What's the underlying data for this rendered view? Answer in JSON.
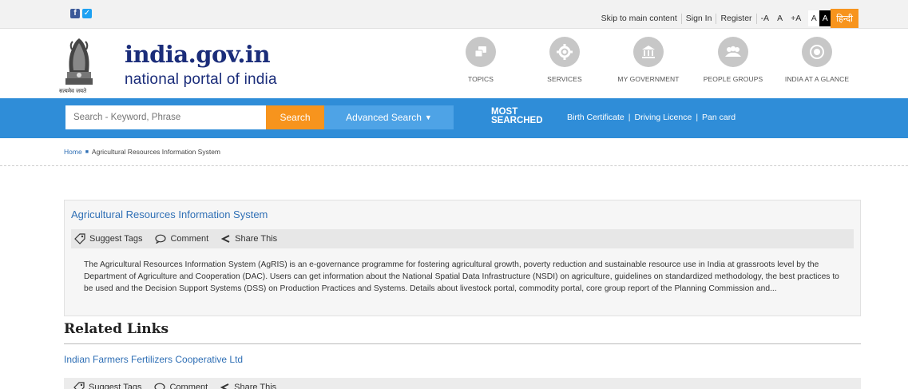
{
  "topbar": {
    "skip_label": "Skip to main content",
    "signin_label": "Sign In",
    "register_label": "Register",
    "font_minus": "-A",
    "font_normal": "A",
    "font_plus": "+A",
    "contrast_light": "A",
    "contrast_dark": "A",
    "hindi_label": "हिन्दी"
  },
  "header": {
    "emblem_caption": "सत्यमेव जयते",
    "title": "india.gov.in",
    "subtitle": "national portal of india",
    "nav": [
      {
        "label": "TOPICS",
        "icon": "topics-icon"
      },
      {
        "label": "SERVICES",
        "icon": "services-icon"
      },
      {
        "label": "MY GOVERNMENT",
        "icon": "government-icon"
      },
      {
        "label": "PEOPLE GROUPS",
        "icon": "people-icon"
      },
      {
        "label": "INDIA AT A GLANCE",
        "icon": "glance-icon"
      }
    ]
  },
  "search": {
    "placeholder": "Search - Keyword, Phrase",
    "button_label": "Search",
    "advanced_label": "Advanced Search",
    "most_searched_line1": "MOST",
    "most_searched_line2": "SEARCHED",
    "most_links": [
      "Birth Certificate",
      "Driving Licence",
      "Pan card"
    ]
  },
  "breadcrumb": {
    "home": "Home",
    "current": "Agricultural Resources Information System"
  },
  "article": {
    "title": "Agricultural Resources Information System",
    "tools": {
      "suggest": "Suggest Tags",
      "comment": "Comment",
      "share": "Share This"
    },
    "body": "The Agricultural Resources Information System (AgRIS) is an e-governance programme for fostering agricultural growth, poverty reduction and sustainable resource use in India at grassroots level by the Department of Agriculture and Cooperation (DAC). Users can get information about the National Spatial Data Infrastructure (NSDI) on agriculture, guidelines on standardized methodology, the best practices to be used and the Decision Support Systems (DSS) on Production Practices and Systems. Details about livestock portal, commodity portal, core group report of the Planning Commission and..."
  },
  "related": {
    "heading": "Related Links",
    "items": [
      {
        "title": "Indian Farmers Fertilizers Cooperative Ltd"
      }
    ]
  },
  "colors": {
    "brand_blue": "#1b2d7a",
    "bar_blue": "#2f8dd8",
    "accent_orange": "#f7941d",
    "link_blue": "#2f6fb5"
  }
}
